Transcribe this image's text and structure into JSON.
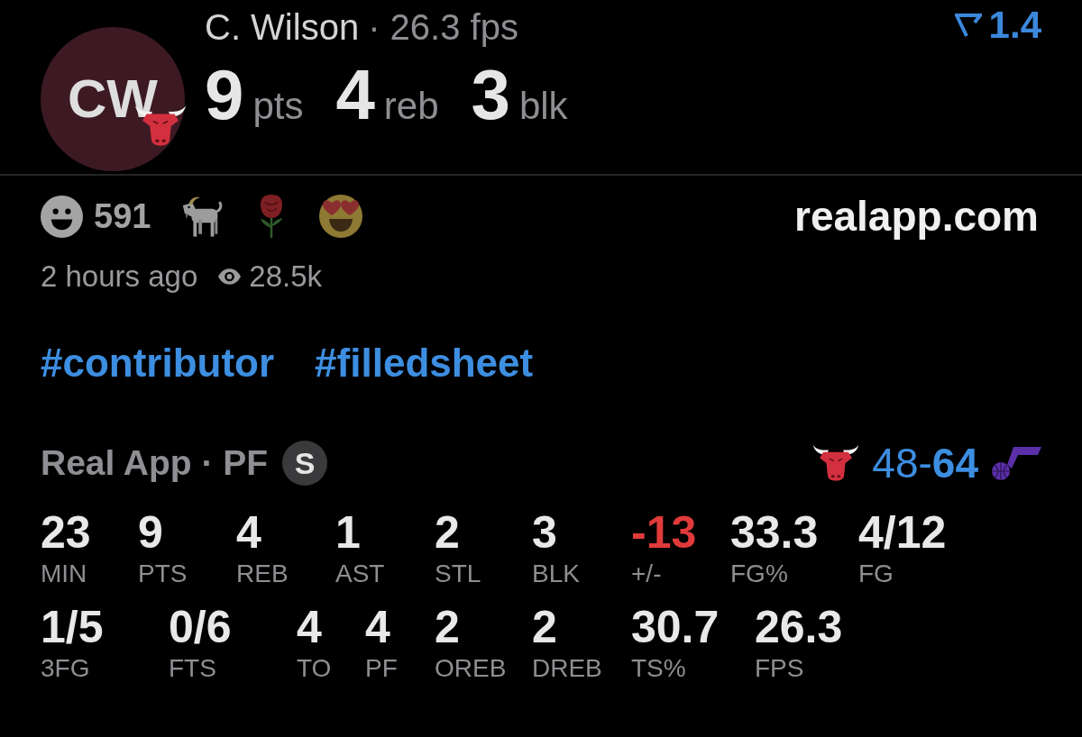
{
  "player": {
    "initials": "CW",
    "name": "C. Wilson",
    "fps": "· 26.3 fps",
    "stats": [
      {
        "value": "9",
        "unit": "pts"
      },
      {
        "value": "4",
        "unit": "reb"
      },
      {
        "value": "3",
        "unit": "blk"
      }
    ]
  },
  "rating": "1.4",
  "reactions": {
    "count": "591"
  },
  "site": "realapp.com",
  "posted": "2 hours ago",
  "views": "28.5k",
  "hashtags": [
    "#contributor",
    "#filledsheet"
  ],
  "game": {
    "source": "Real App · PF",
    "badge": "S",
    "score": "48-**64**"
  },
  "box_score": [
    [
      {
        "value": "23",
        "label": "MIN",
        "color": "#e8e8e8"
      },
      {
        "value": "9",
        "label": "PTS",
        "color": "#e8e8e8"
      },
      {
        "value": "4",
        "label": "REB",
        "color": "#e8e8e8"
      },
      {
        "value": "1",
        "label": "AST",
        "color": "#e8e8e8"
      },
      {
        "value": "2",
        "label": "STL",
        "color": "#e8e8e8"
      },
      {
        "value": "3",
        "label": "BLK",
        "color": "#e8e8e8"
      },
      {
        "value": "-13",
        "label": "+/-",
        "color": "#e03a3a"
      },
      {
        "value": "33.3",
        "label": "FG%",
        "color": "#e8e8e8"
      },
      {
        "value": "4/12",
        "label": "FG",
        "color": "#e8e8e8"
      }
    ],
    [
      {
        "value": "1/5",
        "label": "3FG",
        "color": "#e8e8e8"
      },
      {
        "value": "0/6",
        "label": "FTS",
        "color": "#e8e8e8"
      },
      {
        "value": "4",
        "label": "TO",
        "color": "#e8e8e8"
      },
      {
        "value": "4",
        "label": "PF",
        "color": "#e8e8e8"
      },
      {
        "value": "2",
        "label": "OREB",
        "color": "#e8e8e8"
      },
      {
        "value": "2",
        "label": "DREB",
        "color": "#e8e8e8"
      },
      {
        "value": "30.7",
        "label": "TS%",
        "color": "#e8e8e8"
      },
      {
        "value": "26.3",
        "label": "FPS",
        "color": "#e8e8e8"
      }
    ]
  ]
}
